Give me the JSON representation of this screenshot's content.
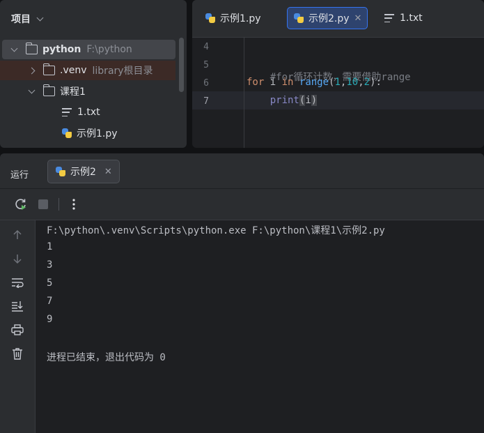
{
  "project": {
    "title": "项目",
    "tree": [
      {
        "name": "python",
        "sub": "F:\\python"
      },
      {
        "name": ".venv",
        "sub": "library根目录"
      },
      {
        "name": "课程1"
      },
      {
        "name": "1.txt"
      },
      {
        "name": "示例1.py"
      }
    ]
  },
  "editor": {
    "tabs": [
      {
        "label": "示例1.py"
      },
      {
        "label": "示例2.py",
        "close": "✕"
      },
      {
        "label": "1.txt"
      }
    ],
    "line_numbers": [
      "4",
      "5",
      "6",
      "7"
    ],
    "lines": {
      "l5_comment": "#for循环计数，需要借助range",
      "l6_for": "for",
      "l6_i": " i ",
      "l6_in": "in",
      "l6_range": "range",
      "l6_open": "(",
      "l6_n1": "1",
      "l6_c1": ",",
      "l6_n2": "10",
      "l6_c2": ",",
      "l6_n3": "2",
      "l6_close": "):",
      "l7_indent": "    ",
      "l7_print": "print",
      "l7_open": "(",
      "l7_arg": "i",
      "l7_close": ")"
    }
  },
  "run": {
    "title": "运行",
    "tab_label": "示例2",
    "tab_close": "✕",
    "output": [
      "F:\\python\\.venv\\Scripts\\python.exe F:\\python\\课程1\\示例2.py",
      "1",
      "3",
      "5",
      "7",
      "9",
      "",
      "进程已结束，退出代码为 0"
    ]
  },
  "colors": {
    "accent": "#3574f0",
    "rerun_green": "#5fb865"
  }
}
